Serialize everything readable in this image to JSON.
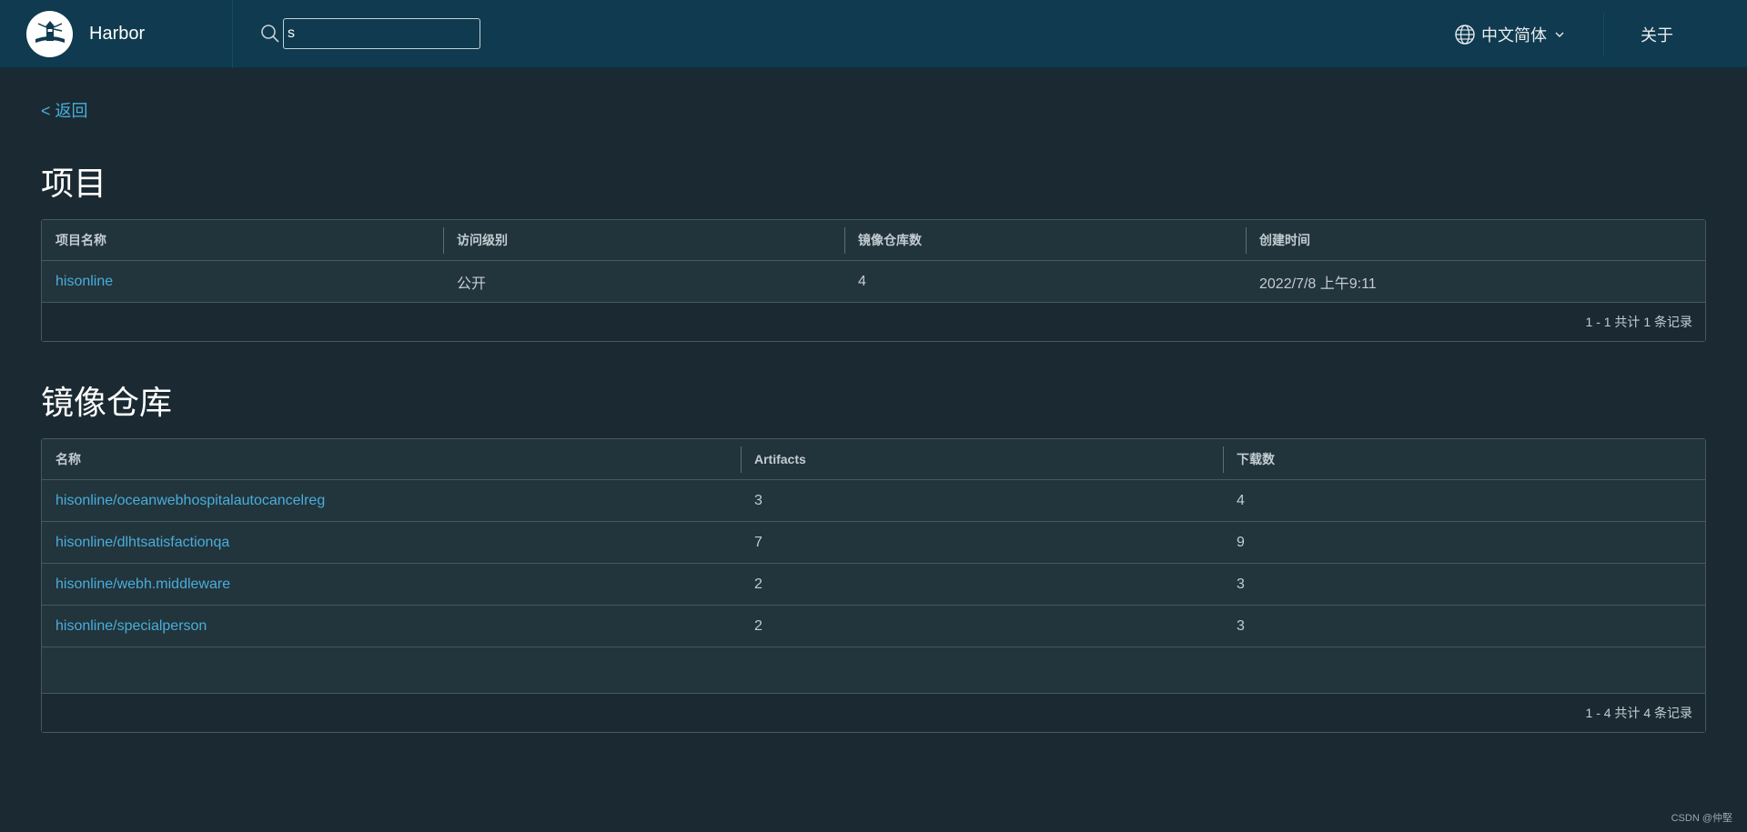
{
  "header": {
    "brand_name": "Harbor",
    "search_value": "s",
    "language_label": "中文简体",
    "about_label": "关于"
  },
  "back_label": "< 返回",
  "projects": {
    "title": "项目",
    "columns": [
      "项目名称",
      "访问级别",
      "镜像仓库数",
      "创建时间"
    ],
    "rows": [
      [
        "hisonline",
        "公开",
        "4",
        "2022/7/8 上午9:11"
      ]
    ],
    "footer": "1 - 1 共计 1 条记录"
  },
  "repositories": {
    "title": "镜像仓库",
    "columns": [
      "名称",
      "Artifacts",
      "下载数"
    ],
    "rows": [
      [
        "hisonline/oceanwebhospitalautocancelreg",
        "3",
        "4"
      ],
      [
        "hisonline/dlhtsatisfactionqa",
        "7",
        "9"
      ],
      [
        "hisonline/webh.middleware",
        "2",
        "3"
      ],
      [
        "hisonline/specialperson",
        "2",
        "3"
      ]
    ],
    "footer": "1 - 4 共计 4 条记录"
  },
  "watermark": "CSDN @仲堅",
  "colors": {
    "header_bg": "#0f3a4f",
    "page_bg": "#1b2a32",
    "link": "#49aeda",
    "border": "#485764"
  }
}
